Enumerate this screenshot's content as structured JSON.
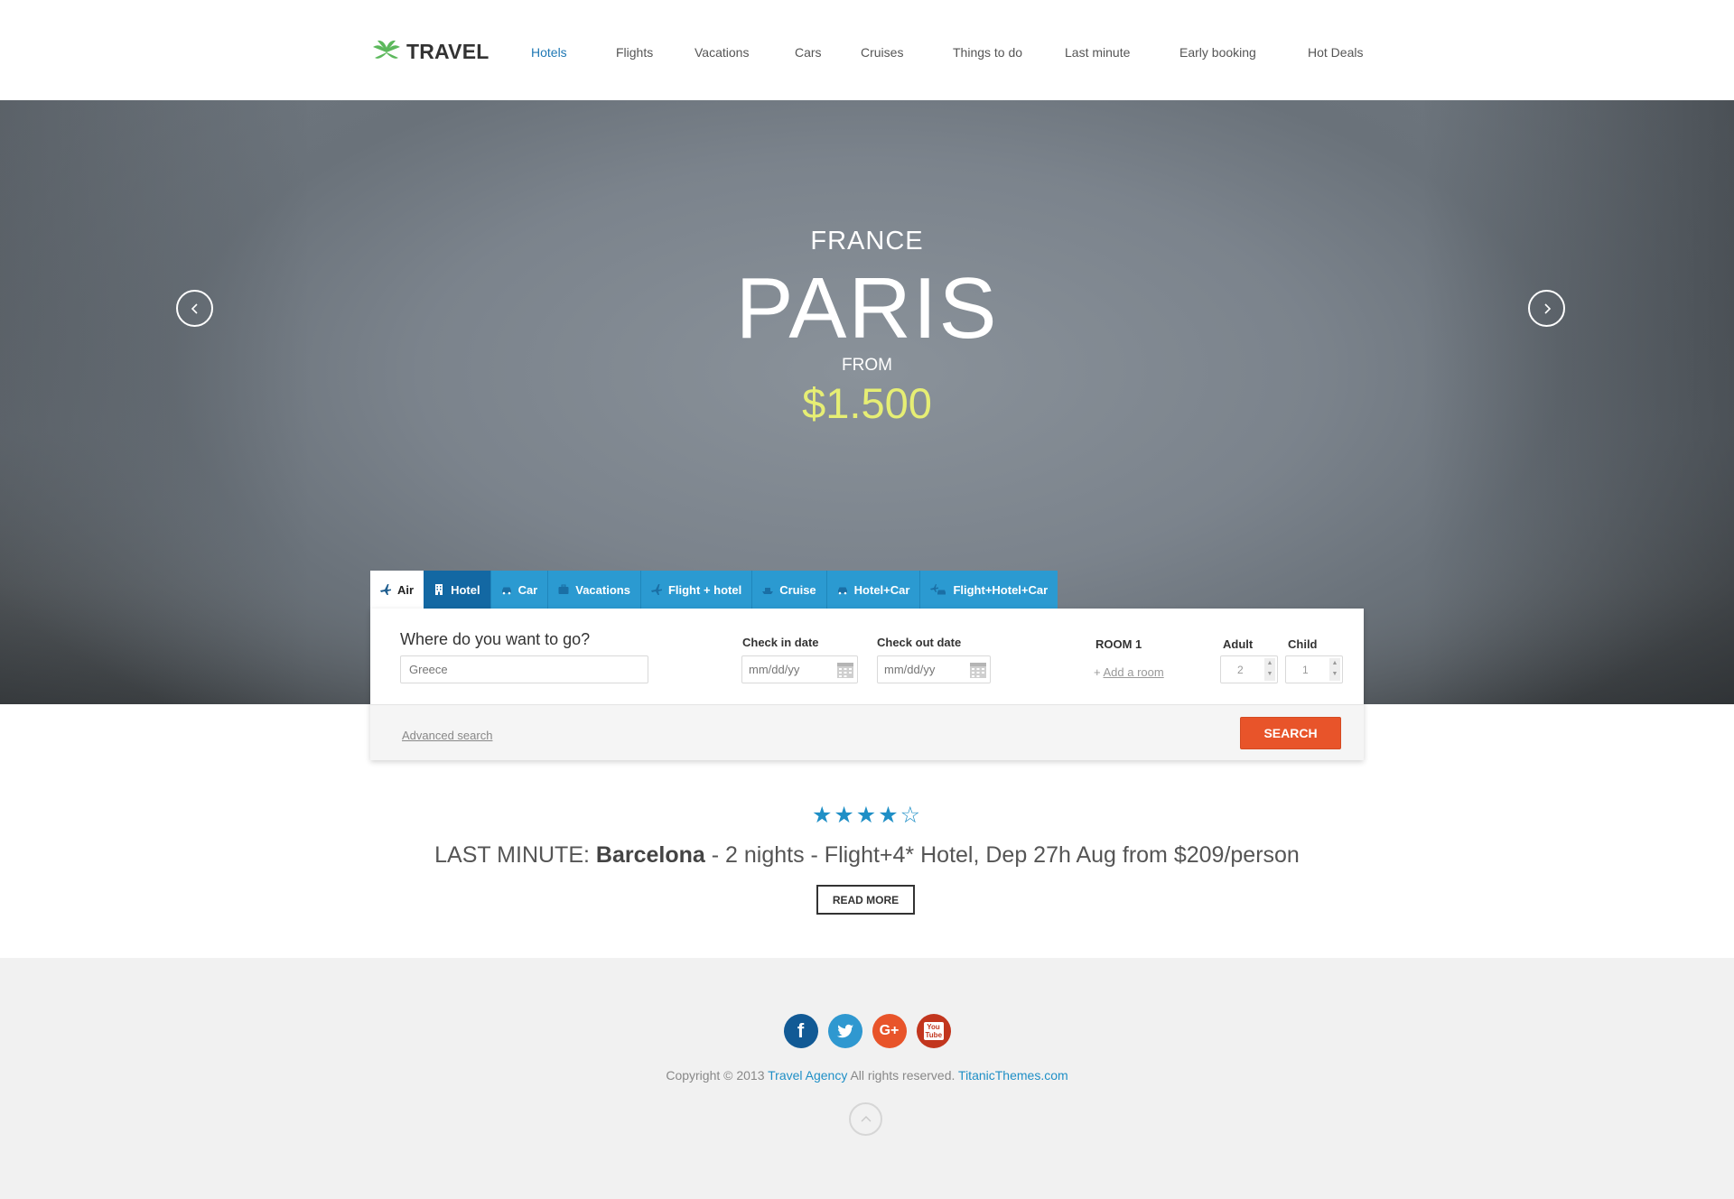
{
  "header": {
    "logo_text": "TRAVEL",
    "nav": [
      {
        "label": "Hotels",
        "active": true
      },
      {
        "label": "Flights"
      },
      {
        "label": "Vacations"
      },
      {
        "label": "Cars"
      },
      {
        "label": "Cruises"
      },
      {
        "label": "Things to do"
      },
      {
        "label": "Last minute"
      },
      {
        "label": "Early booking"
      },
      {
        "label": "Hot Deals"
      }
    ]
  },
  "hero": {
    "country": "FRANCE",
    "city": "PARIS",
    "from": "FROM",
    "price": "$1.500",
    "price_color": "#e6ee74",
    "prev_icon": "chevron-left-icon",
    "next_icon": "chevron-right-icon"
  },
  "search": {
    "tabs": [
      {
        "label": "Air",
        "icon": "plane-icon",
        "active": true
      },
      {
        "label": "Hotel",
        "icon": "building-icon",
        "selected_dark": true
      },
      {
        "label": "Car",
        "icon": "car-icon"
      },
      {
        "label": "Vacations",
        "icon": "suitcase-icon"
      },
      {
        "label": "Flight + hotel",
        "icon": "plane-icon"
      },
      {
        "label": "Cruise",
        "icon": "ship-icon"
      },
      {
        "label": "Hotel+Car",
        "icon": "car-icon"
      },
      {
        "label": "Flight+Hotel+Car",
        "icon": "combo-icon"
      }
    ],
    "where_label": "Where do you want to go?",
    "where_placeholder": "Greece",
    "checkin_label": "Check in date",
    "checkin_placeholder": "mm/dd/yy",
    "checkout_label": "Check out date",
    "checkout_placeholder": "mm/dd/yy",
    "room_label": "ROOM 1",
    "add_room_prefix": "+",
    "add_room_link": "Add a room",
    "adult_label": "Adult",
    "adult_value": "2",
    "child_label": "Child",
    "child_value": "1",
    "advanced_search": "Advanced search",
    "search_button": "SEARCH",
    "accent": "#2b9ad1",
    "button_color": "#e8542a"
  },
  "last_minute": {
    "stars": "★★★★☆",
    "prefix": "LAST MINUTE:",
    "destination": "Barcelona",
    "details": "- 2 nights - Flight+4* Hotel, Dep 27h Aug from $209/person",
    "read_more": "READ MORE"
  },
  "footer": {
    "socials": [
      {
        "name": "facebook-icon",
        "glyph": "f",
        "color": "#125a95"
      },
      {
        "name": "twitter-icon",
        "glyph": "t",
        "color": "#2f98d0"
      },
      {
        "name": "google-plus-icon",
        "glyph": "G+",
        "color": "#e8542a"
      },
      {
        "name": "youtube-icon",
        "glyph": "You Tube",
        "color": "#c2361e"
      }
    ],
    "copyright_prefix": "Copyright © 2013",
    "agency_link": "Travel Agency",
    "rights": "All rights reserved.",
    "site_link": "TitanicThemes.com"
  }
}
